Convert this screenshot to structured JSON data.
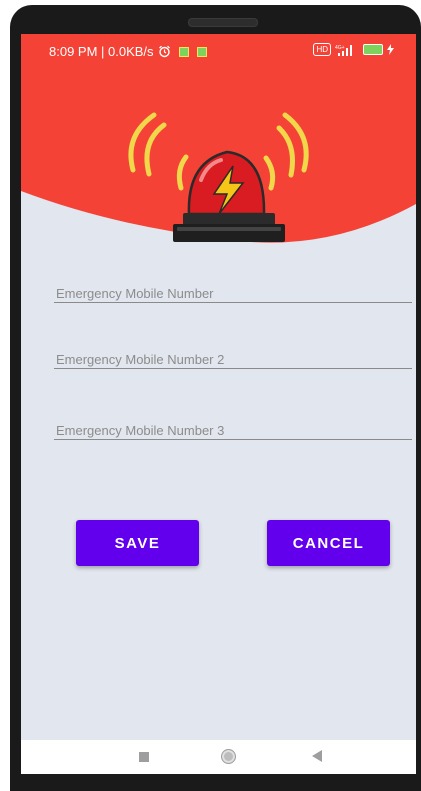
{
  "status_bar": {
    "time_info": "8:09 PM | 0.0KB/s",
    "alarm_icon": "alarm-clock-icon",
    "network_badge": "HD",
    "network_label": "4G+",
    "battery_icon": "battery-charging-icon"
  },
  "header": {
    "icon": "emergency-siren-icon",
    "background_color": "#f44336"
  },
  "form": {
    "fields": [
      {
        "placeholder": "Emergency Mobile Number",
        "value": ""
      },
      {
        "placeholder": "Emergency Mobile Number 2",
        "value": ""
      },
      {
        "placeholder": "Emergency Mobile Number 3",
        "value": ""
      }
    ]
  },
  "buttons": {
    "save_label": "SAVE",
    "cancel_label": "CANCEL",
    "color": "#6200ee"
  },
  "nav_bar": {
    "recents_icon": "square-recents-icon",
    "home_icon": "circle-home-icon",
    "back_icon": "triangle-back-icon"
  }
}
